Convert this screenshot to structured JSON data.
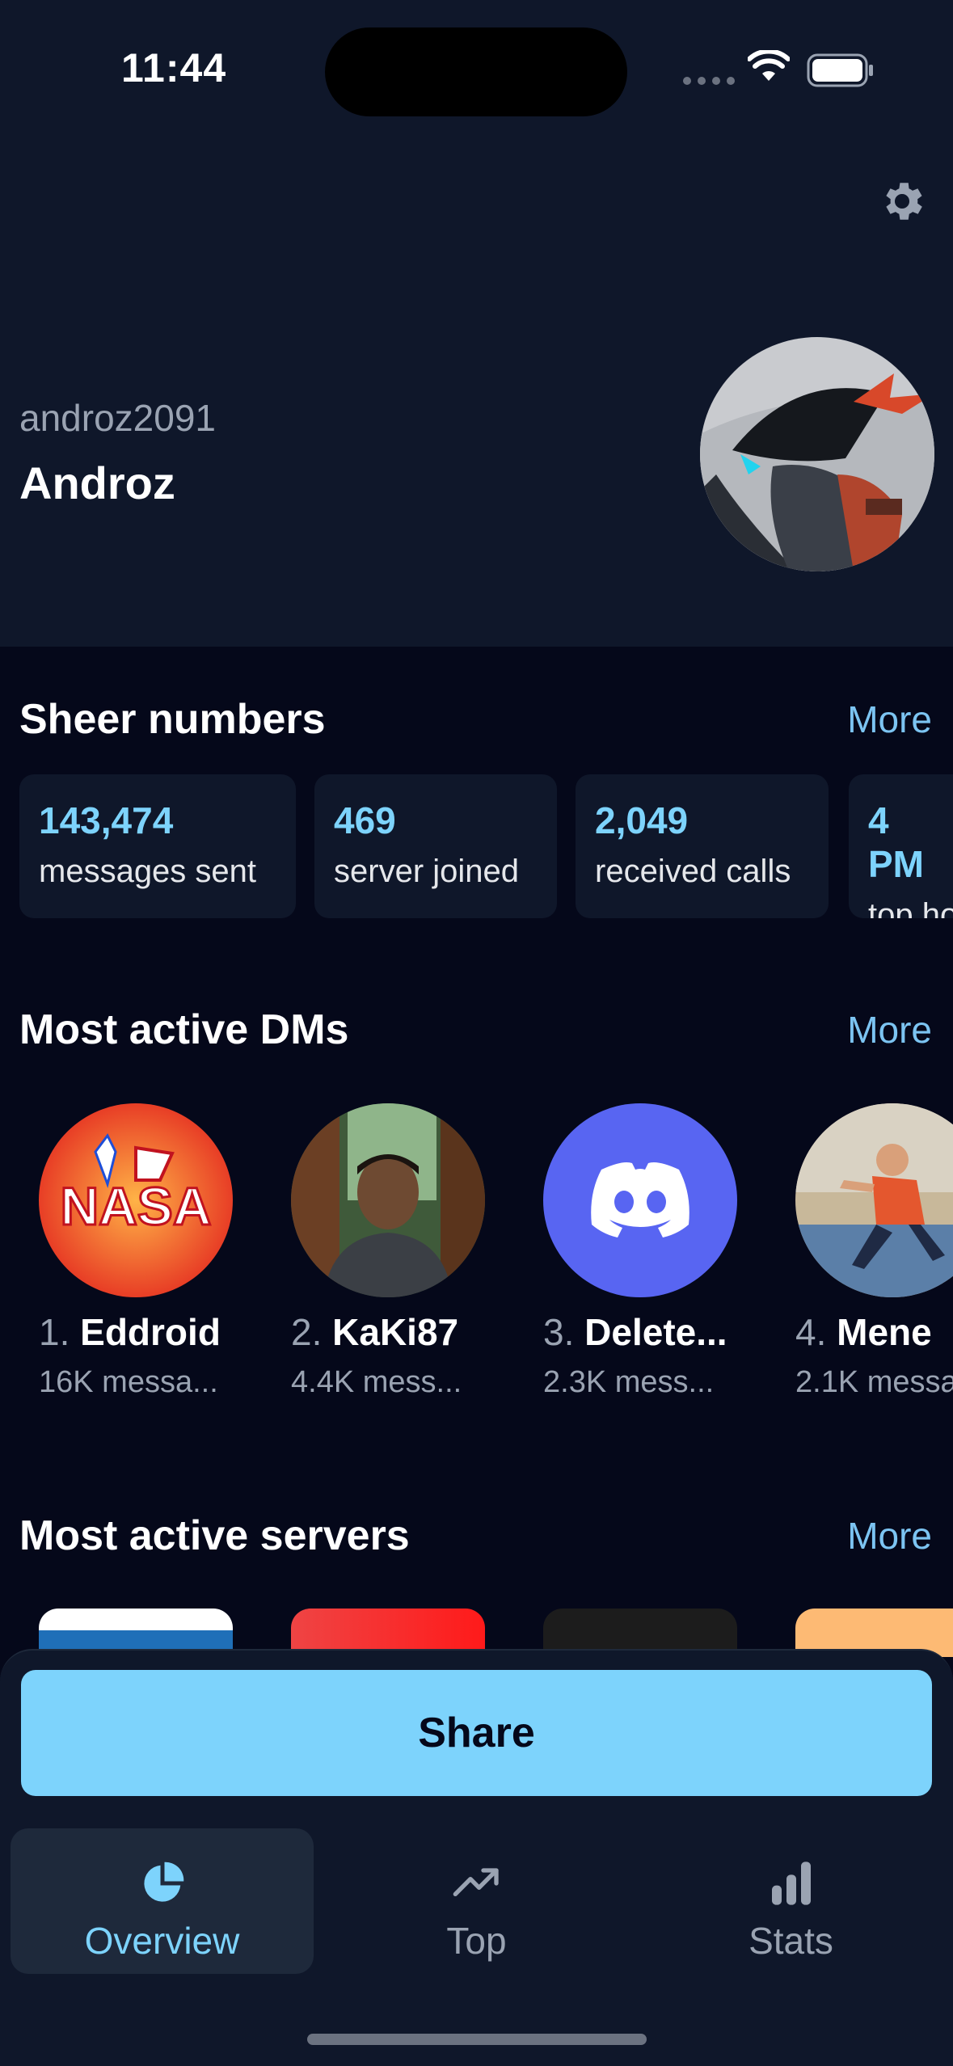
{
  "status_bar": {
    "time": "11:44"
  },
  "profile": {
    "username": "androz2091",
    "display_name": "Androz"
  },
  "sheer_numbers": {
    "title": "Sheer numbers",
    "more_label": "More",
    "stats": [
      {
        "value": "143,474",
        "label": "messages sent"
      },
      {
        "value": "469",
        "label": "server joined"
      },
      {
        "value": "2,049",
        "label": "received calls"
      },
      {
        "value": "4 PM",
        "label": "top hour"
      }
    ]
  },
  "dms": {
    "title": "Most active DMs",
    "more_label": "More",
    "items": [
      {
        "rank": "1.",
        "name": "Eddroid",
        "sub": "16K messa..."
      },
      {
        "rank": "2.",
        "name": "KaKi87",
        "sub": "4.4K mess..."
      },
      {
        "rank": "3.",
        "name": "Delete...",
        "sub": "2.3K mess..."
      },
      {
        "rank": "4.",
        "name": "Mene",
        "sub": "2.1K messa"
      }
    ]
  },
  "servers": {
    "title": "Most active servers",
    "more_label": "More"
  },
  "share": {
    "label": "Share"
  },
  "tabs": [
    {
      "label": "Overview",
      "icon": "pie-chart-icon"
    },
    {
      "label": "Top",
      "icon": "trending-up-icon"
    },
    {
      "label": "Stats",
      "icon": "bar-chart-icon"
    }
  ],
  "colors": {
    "accent": "#7dd3fc",
    "header_bg": "#0f172a",
    "page_bg": "#05081a"
  }
}
